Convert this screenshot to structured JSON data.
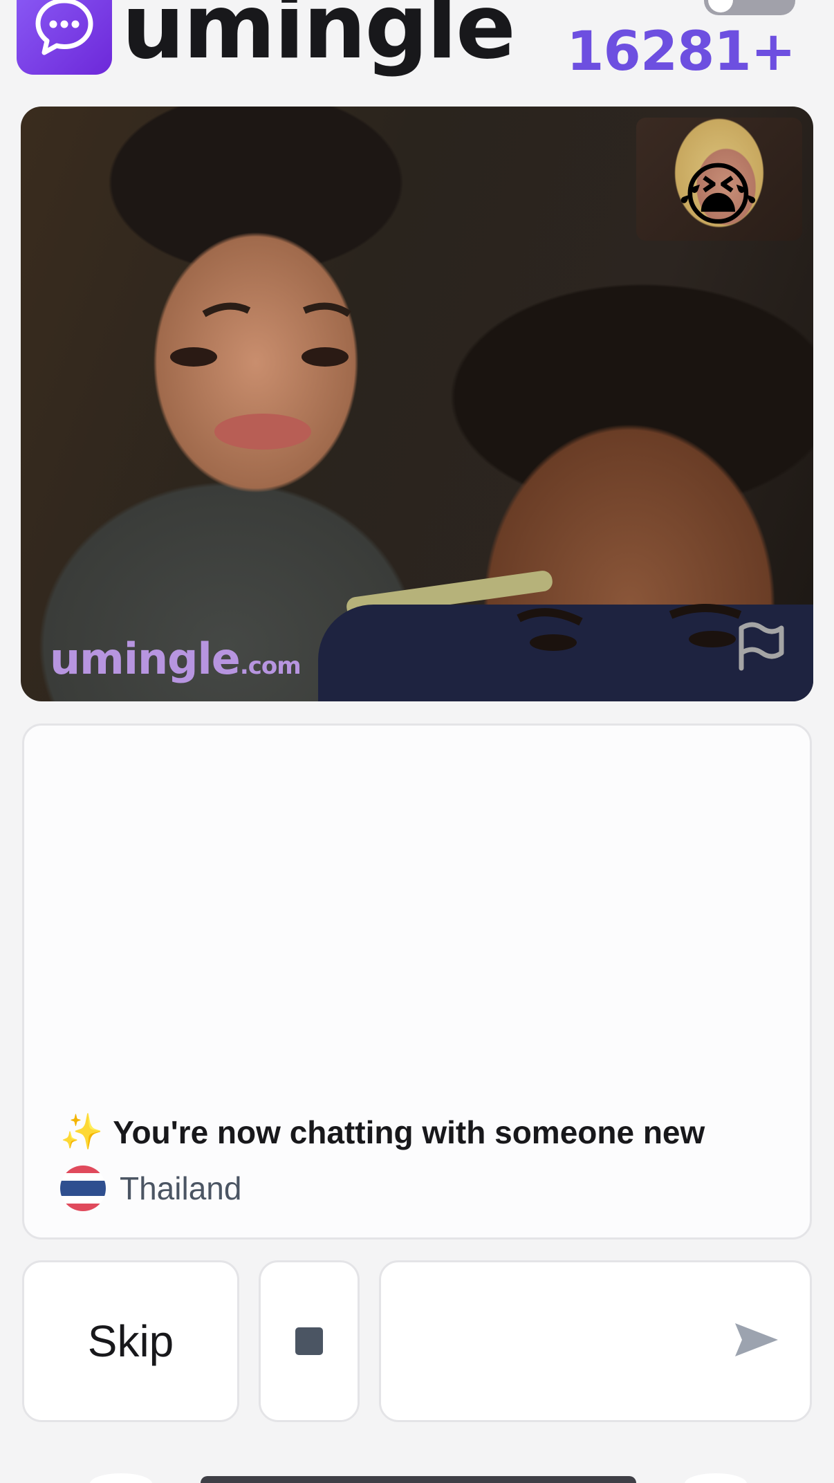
{
  "header": {
    "brand": "umingle",
    "online_count": "16281+",
    "logo_icon": "chat-bubble-icon",
    "toggle_icon": "toggle-switch"
  },
  "video": {
    "pip_emoji": "😭",
    "watermark_name": "umingle",
    "watermark_tld": ".com",
    "report_icon": "flag-icon"
  },
  "chat": {
    "sparkle": "✨",
    "status_message": "You're now chatting with someone new",
    "country": "Thailand",
    "country_flag_icon": "thailand-flag-icon"
  },
  "controls": {
    "skip_label": "Skip",
    "stop_icon": "stop-square-icon",
    "message_placeholder": "",
    "send_icon": "send-arrow-icon"
  },
  "colors": {
    "accent": "#6d4fe0",
    "logo_gradient_start": "#8b5cf6",
    "logo_gradient_end": "#6d28d9",
    "watermark": "#b795e0"
  }
}
